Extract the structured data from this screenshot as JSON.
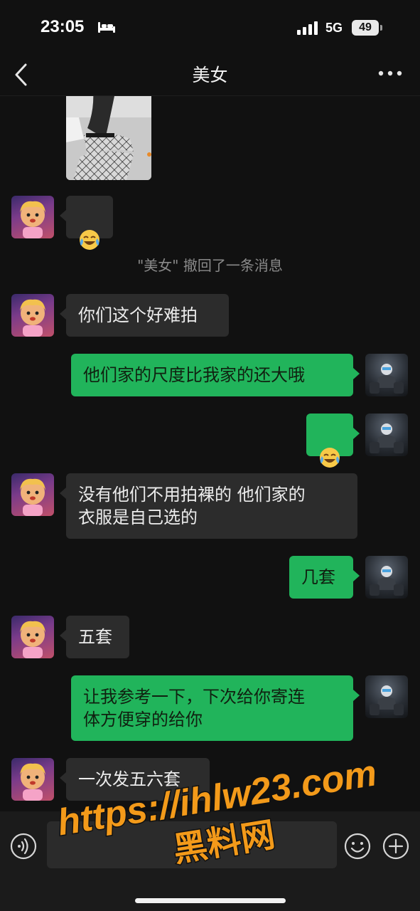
{
  "status": {
    "time": "23:05",
    "network": "5G",
    "battery": "49"
  },
  "nav": {
    "title": "美女"
  },
  "system_notice": "\"美女\" 撤回了一条消息",
  "messages": [
    {
      "side": "in",
      "text": "你们这个好难拍"
    },
    {
      "side": "out",
      "text": "他们家的尺度比我家的还大哦"
    },
    {
      "side": "in",
      "text": "没有他们不用拍裸的 他们家的\n衣服是自己选的"
    },
    {
      "side": "out",
      "text": "几套"
    },
    {
      "side": "in",
      "text": "五套"
    },
    {
      "side": "out",
      "text": "让我参考一下，下次给你寄连\n体方便穿的给你"
    },
    {
      "side": "in",
      "text": "一次发五六套"
    }
  ],
  "watermark": {
    "line1": "https://ihlw23.com",
    "line2": "黑料网"
  },
  "colors": {
    "outgoing_bubble": "#21b45b",
    "incoming_bubble": "#2c2c2c",
    "background": "#111111",
    "watermark": "#f39a1a"
  },
  "icons": [
    "bed-icon",
    "signal-icon",
    "back-icon",
    "more-icon",
    "laugh-cry-emoji",
    "voice-icon",
    "emoji-icon",
    "plus-icon"
  ]
}
